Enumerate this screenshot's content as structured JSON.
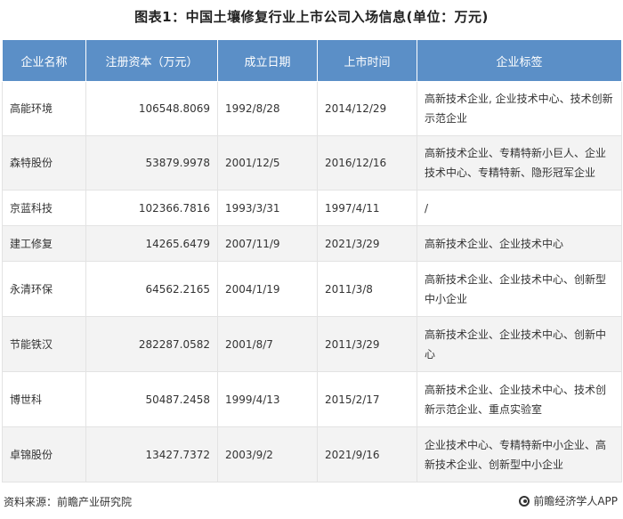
{
  "title": "图表1：中国土壤修复行业上市公司入场信息(单位：万元)",
  "table": {
    "headers": [
      "企业名称",
      "注册资本（万元）",
      "成立日期",
      "上市时间",
      "企业标签"
    ],
    "rows": [
      {
        "name": "高能环境",
        "capital": "106548.8069",
        "established": "1992/8/28",
        "listed": "2014/12/29",
        "tags": "高新技术企业, 企业技术中心、技术创新示范企业"
      },
      {
        "name": "森特股份",
        "capital": "53879.9978",
        "established": "2001/12/5",
        "listed": "2016/12/16",
        "tags": "高新技术企业、专精特新小巨人、企业技术中心、专精特新、隐形冠军企业"
      },
      {
        "name": "京蓝科技",
        "capital": "102366.7816",
        "established": "1993/3/31",
        "listed": "1997/4/11",
        "tags": "/"
      },
      {
        "name": "建工修复",
        "capital": "14265.6479",
        "established": "2007/11/9",
        "listed": "2021/3/29",
        "tags": "高新技术企业、企业技术中心"
      },
      {
        "name": "永清环保",
        "capital": "64562.2165",
        "established": "2004/1/19",
        "listed": "2011/3/8",
        "tags": "高新技术企业、企业技术中心、创新型中小企业"
      },
      {
        "name": "节能铁汉",
        "capital": "282287.0582",
        "established": "2001/8/7",
        "listed": "2011/3/29",
        "tags": "高新技术企业、企业技术中心、创新中心"
      },
      {
        "name": "博世科",
        "capital": "50487.2458",
        "established": "1999/4/13",
        "listed": "2015/2/17",
        "tags": "高新技术企业、企业技术中心、技术创新示范企业、重点实验室"
      },
      {
        "name": "卓锦股份",
        "capital": "13427.7372",
        "established": "2003/9/2",
        "listed": "2021/9/16",
        "tags": "企业技术中心、专精特新中小企业、高新技术企业、创新型中小企业"
      }
    ]
  },
  "footer": {
    "source": "资料来源：前瞻产业研究院",
    "brand": "前瞻经济学人APP",
    "brand_icon": "circle-logo-icon"
  },
  "watermark": "前瞻产业研究院",
  "colors": {
    "header_bg": "#5b8fc7",
    "stripe_bg": "#f3f3f3"
  }
}
